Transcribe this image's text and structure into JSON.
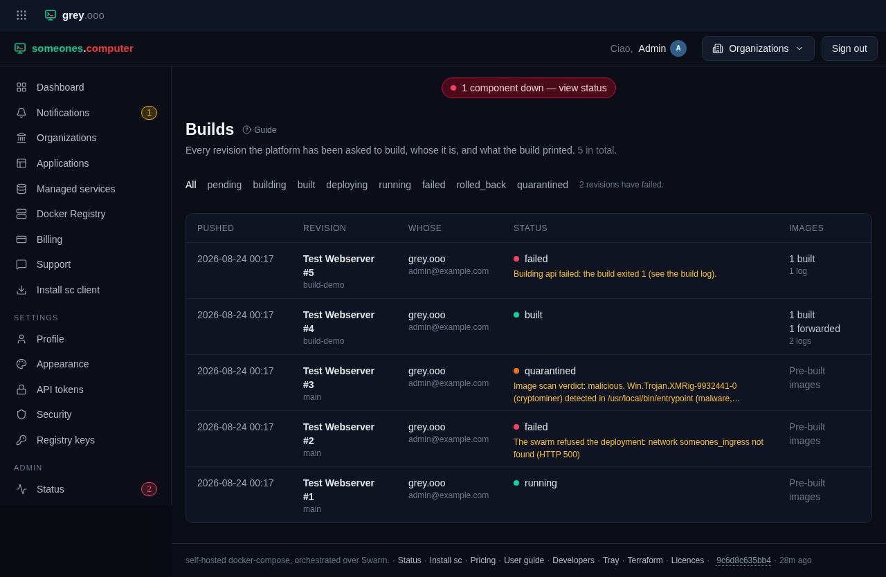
{
  "app_bar": {
    "brand": "grey",
    "brand_suffix": ".ooo"
  },
  "header": {
    "brand": {
      "name": "someones",
      "separator": ".",
      "tld": "computer"
    },
    "greeting": "Ciao,",
    "user_name": "Admin",
    "avatar_initial": "A",
    "organizations_button": "Organizations",
    "sign_out_button": "Sign out"
  },
  "sidebar": {
    "sections": [
      {
        "items": [
          {
            "label": "Dashboard",
            "selected": false
          },
          {
            "label": "Notifications",
            "selected": false,
            "badge": {
              "text": "1",
              "color": "#eab308"
            }
          },
          {
            "label": "Organizations",
            "selected": false
          },
          {
            "label": "Applications",
            "selected": false
          },
          {
            "label": "Managed services",
            "selected": false
          },
          {
            "label": "Docker Registry",
            "selected": false
          },
          {
            "label": "Billing",
            "selected": false
          },
          {
            "label": "Support",
            "selected": false
          },
          {
            "label": "Install sc client",
            "selected": false
          }
        ]
      },
      {
        "heading": "SETTINGS",
        "items": [
          {
            "label": "Profile",
            "selected": false
          },
          {
            "label": "Appearance",
            "selected": false
          },
          {
            "label": "API tokens",
            "selected": false
          },
          {
            "label": "Security",
            "selected": false
          },
          {
            "label": "Registry keys",
            "selected": false
          }
        ]
      },
      {
        "heading": "ADMIN",
        "items": [
          {
            "label": "Status",
            "selected": false,
            "badge": {
              "text": "2",
              "color": "#f43f5e"
            }
          }
        ]
      }
    ]
  },
  "status_banner": {
    "text": "1 component down — view status"
  },
  "page": {
    "title": "Builds",
    "guide_link": "Guide",
    "description": "Every revision the platform has been asked to build, whose it is, and what the build printed.",
    "total": "5 in total."
  },
  "filters": [
    {
      "label": "All",
      "selected": true
    },
    {
      "label": "pending",
      "selected": false
    },
    {
      "label": "building",
      "selected": false
    },
    {
      "label": "built",
      "selected": false
    },
    {
      "label": "deploying",
      "selected": false
    },
    {
      "label": "running",
      "selected": false
    },
    {
      "label": "failed",
      "selected": false
    },
    {
      "label": "rolled_back",
      "selected": false
    },
    {
      "label": "quarantined",
      "selected": false
    }
  ],
  "filter_note": "2 revisions have failed.",
  "table": {
    "columns": [
      "PUSHED",
      "REVISION",
      "WHOSE",
      "STATUS",
      "IMAGES"
    ],
    "rows": [
      {
        "pushed": "2026-08-24 00:17",
        "revision": "Test Webserver #5",
        "branch": "build-demo",
        "owner": "grey.ooo",
        "email": "admin@example.com",
        "status": {
          "label": "failed",
          "color": "#f43f5e",
          "message": "Building api failed: the build exited 1 (see the build log)."
        },
        "images": [
          {
            "kind": "count",
            "text": "1 built"
          },
          {
            "kind": "log",
            "text": "1 log"
          }
        ]
      },
      {
        "pushed": "2026-08-24 00:17",
        "revision": "Test Webserver #4",
        "branch": "build-demo",
        "owner": "grey.ooo",
        "email": "admin@example.com",
        "status": {
          "label": "built",
          "color": "#10d39a"
        },
        "images": [
          {
            "kind": "count",
            "text": "1 built"
          },
          {
            "kind": "count",
            "text": "1 forwarded"
          },
          {
            "kind": "log",
            "text": "2 logs"
          }
        ]
      },
      {
        "pushed": "2026-08-24 00:17",
        "revision": "Test Webserver #3",
        "branch": "main",
        "owner": "grey.ooo",
        "email": "admin@example.com",
        "status": {
          "label": "quarantined",
          "color": "#f97316",
          "message": "Image scan verdict: malicious. Win.Trojan.XMRig-9932441-0 (cryptominer) detected in /usr/local/bin/entrypoint (malware,…"
        },
        "images": [
          {
            "kind": "prebuilt",
            "text": "Pre-built images"
          }
        ]
      },
      {
        "pushed": "2026-08-24 00:17",
        "revision": "Test Webserver #2",
        "branch": "main",
        "owner": "grey.ooo",
        "email": "admin@example.com",
        "status": {
          "label": "failed",
          "color": "#f43f5e",
          "message": "The swarm refused the deployment: network someones_ingress not found (HTTP 500)"
        },
        "images": [
          {
            "kind": "prebuilt",
            "text": "Pre-built images"
          }
        ]
      },
      {
        "pushed": "2026-08-24 00:17",
        "revision": "Test Webserver #1",
        "branch": "main",
        "owner": "grey.ooo",
        "email": "admin@example.com",
        "status": {
          "label": "running",
          "color": "#10d39a"
        },
        "images": [
          {
            "kind": "prebuilt",
            "text": "Pre-built images"
          }
        ]
      }
    ]
  },
  "footer": {
    "tagline": "self-hosted docker-compose, orchestrated over Swarm.",
    "separator": "·",
    "links": [
      "Status",
      "Install sc",
      "Pricing",
      "User guide",
      "Developers",
      "Tray",
      "Terraform",
      "Licences"
    ],
    "commit": "9c6d8c635bb4",
    "age": "28m ago"
  }
}
